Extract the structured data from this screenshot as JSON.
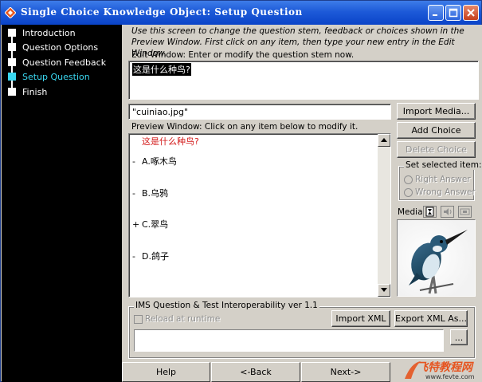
{
  "window": {
    "title": "Single Choice Knowledge Object: Setup Question"
  },
  "sidebar": {
    "items": [
      {
        "label": "Introduction",
        "active": false
      },
      {
        "label": "Question Options",
        "active": false
      },
      {
        "label": "Question Feedback",
        "active": false
      },
      {
        "label": "Setup Question",
        "active": true
      },
      {
        "label": "Finish",
        "active": false
      }
    ]
  },
  "main": {
    "instructions": "Use this screen to change the question stem, feedback or choices shown in the Preview Window. First click on any item, then type your new entry in the Edit Window.",
    "edit_label": "Edit Window: Enter or modify the question stem now.",
    "edit_value": "这是什么种鸟?",
    "media_file": "\"cuiniao.jpg\"",
    "preview_label": "Preview Window: Click on any item below to modify it.",
    "preview": {
      "question": "这是什么种鸟?",
      "choices": [
        {
          "mark": "-",
          "label": "A.啄木鸟"
        },
        {
          "mark": "-",
          "label": "B.乌鸦"
        },
        {
          "mark": "+",
          "label": "C.翠鸟"
        },
        {
          "mark": "-",
          "label": "D.鸽子"
        }
      ]
    },
    "buttons": {
      "import_media": "Import Media...",
      "add_choice": "Add Choice",
      "delete_choice": "Delete Choice"
    },
    "set_selected": {
      "title": "Set selected item:",
      "right": "Right Answer",
      "wrong": "Wrong Answer"
    },
    "media_label": "Media:",
    "ims": {
      "title": "IMS Question & Test Interoperability ver 1.1",
      "reload": "Reload at runtime",
      "import_xml": "Import XML",
      "export_xml": "Export XML As...",
      "browse": "..."
    }
  },
  "footer": {
    "help": "Help",
    "back": "<-Back",
    "next": "Next->"
  },
  "watermark": {
    "text": "飞特教程网",
    "url": "www.fevte.com"
  },
  "colors": {
    "titlebar": "#0a43c8",
    "active_nav": "#3ad7f0",
    "question_text": "#d31a1a"
  }
}
